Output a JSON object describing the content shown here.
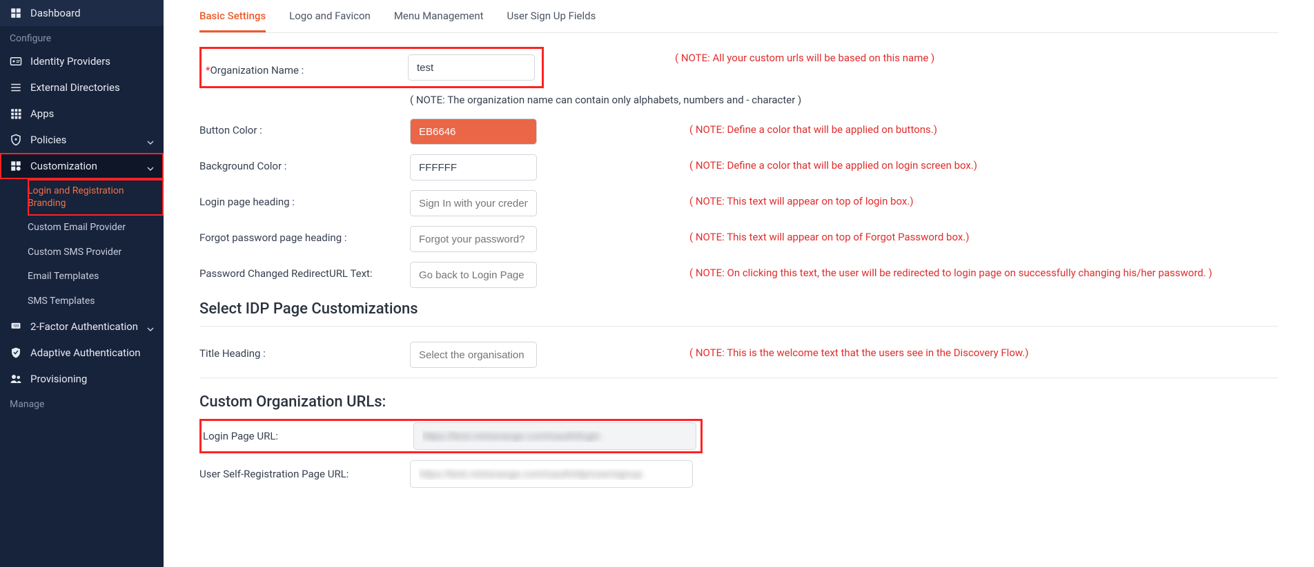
{
  "sidebar": {
    "dashboard": "Dashboard",
    "section_configure": "Configure",
    "identity_providers": "Identity Providers",
    "external_directories": "External Directories",
    "apps": "Apps",
    "policies": "Policies",
    "customization": "Customization",
    "customization_children": {
      "login_branding": "Login and Registration Branding",
      "email_provider": "Custom Email Provider",
      "sms_provider": "Custom SMS Provider",
      "email_templates": "Email Templates",
      "sms_templates": "SMS Templates"
    },
    "two_factor": "2-Factor Authentication",
    "adaptive_auth": "Adaptive Authentication",
    "provisioning": "Provisioning",
    "section_manage": "Manage"
  },
  "tabs": {
    "basic": "Basic Settings",
    "logo": "Logo and Favicon",
    "menu": "Menu Management",
    "signup": "User Sign Up Fields"
  },
  "fields": {
    "org_name_label": "Organization Name :",
    "org_name_value": "test",
    "org_name_note": "( NOTE: All your custom urls will be based on this name )",
    "org_name_subnote": "( NOTE: The organization name can contain only alphabets, numbers and - character )",
    "button_color_label": "Button Color :",
    "button_color_value": "EB6646",
    "button_color_note": "( NOTE: Define a color that will be applied on buttons.)",
    "bg_color_label": "Background Color :",
    "bg_color_value": "FFFFFF",
    "bg_color_note": "( NOTE: Define a color that will be applied on login screen box.)",
    "login_heading_label": "Login page heading :",
    "login_heading_placeholder": "Sign In with your creden",
    "login_heading_note": "( NOTE: This text will appear on top of login box.)",
    "forgot_heading_label": "Forgot password page heading :",
    "forgot_heading_placeholder": "Forgot your password?",
    "forgot_heading_note": "( NOTE: This text will appear on top of Forgot Password box.)",
    "pwd_redirect_label": "Password Changed RedirectURL Text:",
    "pwd_redirect_placeholder": "Go back to Login Page",
    "pwd_redirect_note": "( NOTE: On clicking this text, the user will be redirected to login page on successfully changing his/her password. )",
    "idp_section": "Select IDP Page Customizations",
    "title_heading_label": "Title Heading :",
    "title_heading_placeholder": "Select the organisation",
    "title_heading_note": "( NOTE: This is the welcome text that the users see in the Discovery Flow.)",
    "urls_section": "Custom Organization URLs:",
    "login_url_label": "Login Page URL:",
    "login_url_value": "https://test.miniorange.com/oauth/login",
    "self_reg_label": "User Self-Registration Page URL:",
    "self_reg_value": "https://test.miniorange.com/oauth/idp/usersignup"
  }
}
